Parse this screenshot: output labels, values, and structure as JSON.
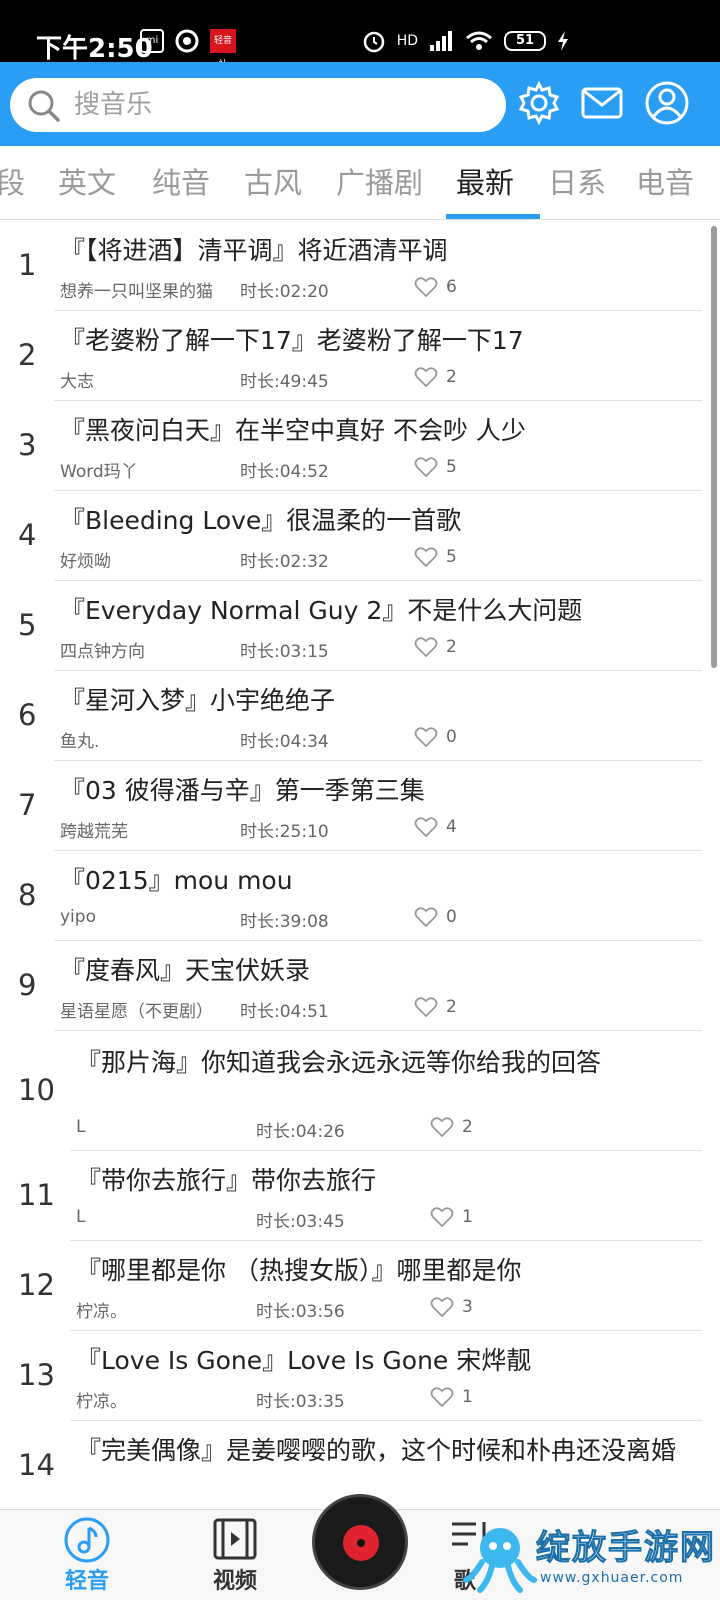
{
  "status_bar": {
    "time": "下午2:50",
    "app_icon_1": "mi",
    "app_icon_3": "轻音社",
    "network": "HD",
    "battery": "51"
  },
  "header": {
    "search_placeholder": "搜音乐",
    "icons": [
      "search-icon",
      "gear-icon",
      "mail-icon",
      "user-icon"
    ],
    "accent_color": "#2a9df4"
  },
  "tabs": [
    {
      "label": "段",
      "active": false
    },
    {
      "label": "英文",
      "active": false
    },
    {
      "label": "纯音",
      "active": false
    },
    {
      "label": "古风",
      "active": false
    },
    {
      "label": "广播剧",
      "active": false
    },
    {
      "label": "最新",
      "active": true
    },
    {
      "label": "日系",
      "active": false
    },
    {
      "label": "电音",
      "active": false
    }
  ],
  "list": [
    {
      "num": "1",
      "title": "『【将进酒】清平调』将近酒清平调",
      "author": "想养一只叫坚果的猫",
      "duration": "时长:02:20",
      "likes": "6"
    },
    {
      "num": "2",
      "title": "『老婆粉了解一下17』老婆粉了解一下17",
      "author": "大志",
      "duration": "时长:49:45",
      "likes": "2"
    },
    {
      "num": "3",
      "title": "『黑夜问白天』在半空中真好 不会吵 人少",
      "author": "Word玛丫",
      "duration": "时长:04:52",
      "likes": "5"
    },
    {
      "num": "4",
      "title": "『Bleeding Love』很温柔的一首歌",
      "author": "好烦呦",
      "duration": "时长:02:32",
      "likes": "5"
    },
    {
      "num": "5",
      "title": "『Everyday Normal Guy 2』不是什么大问题",
      "author": "四点钟方向",
      "duration": "时长:03:15",
      "likes": "2"
    },
    {
      "num": "6",
      "title": "『星河入梦』小宇绝绝子",
      "author": "鱼丸.",
      "duration": "时长:04:34",
      "likes": "0"
    },
    {
      "num": "7",
      "title": "『03 彼得潘与辛』第一季第三集",
      "author": "跨越荒芜",
      "duration": "时长:25:10",
      "likes": "4"
    },
    {
      "num": "8",
      "title": "『0215』mou mou",
      "author": "yipo",
      "duration": "时长:39:08",
      "likes": "0"
    },
    {
      "num": "9",
      "title": "『度春风』天宝伏妖录",
      "author": "星语星愿（不更剧）",
      "duration": "时长:04:51",
      "likes": "2"
    },
    {
      "num": "10",
      "title": "『那片海』你知道我会永远永远等你给我的回答",
      "author": "L",
      "duration": "时长:04:26",
      "likes": "2"
    },
    {
      "num": "11",
      "title": "『带你去旅行』带你去旅行",
      "author": "L",
      "duration": "时长:03:45",
      "likes": "1"
    },
    {
      "num": "12",
      "title": "『哪里都是你 （热搜女版）』哪里都是你",
      "author": "柠凉。",
      "duration": "时长:03:56",
      "likes": "3"
    },
    {
      "num": "13",
      "title": "『Love Is Gone』Love Is Gone 宋烨靓",
      "author": "柠凉。",
      "duration": "时长:03:35",
      "likes": "1"
    },
    {
      "num": "14",
      "title": "『完美偶像』是姜嘤嘤的歌，这个时候和朴冉还没离婚",
      "author": "",
      "duration": "",
      "likes": ""
    }
  ],
  "bottom_nav": [
    {
      "label": "轻音",
      "icon": "music-note-icon",
      "active": true
    },
    {
      "label": "视频",
      "icon": "film-icon",
      "active": false
    },
    {
      "label": "歌",
      "icon": "playlist-icon",
      "active": false
    }
  ],
  "watermark": {
    "text": "绽放手游网",
    "url": "www.gxhuaer.com"
  }
}
